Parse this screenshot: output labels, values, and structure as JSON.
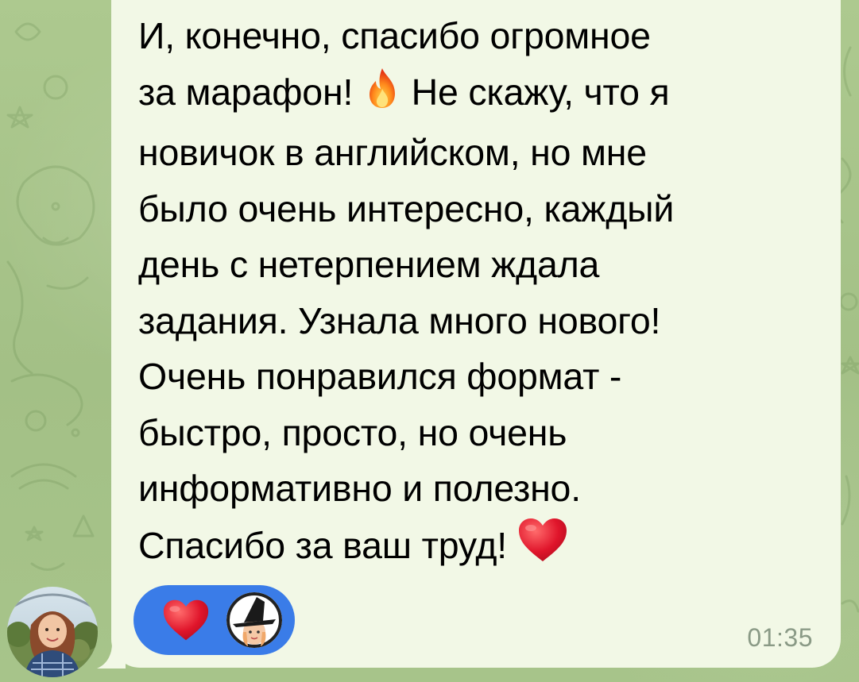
{
  "message": {
    "text_before_fire": "И, конечно, спасибо огромное\nза марафон! ",
    "text_after_fire": " Не скажу, что я\nновичок в английском, но мне\nбыло очень интересно, каждый\nдень с нетерпением ждала\nзадания. Узнала много нового!\nОчень понравился формат -\nбыстро, просто, но очень\nинформативно и полезно.\nСпасибо за ваш труд! ",
    "fire_emoji": "fire-icon",
    "heart_emoji": "red-heart-icon",
    "timestamp": "01:35"
  },
  "reactions": {
    "emoji": "red-heart-icon",
    "reactor_avatar": "witch-avatar"
  },
  "colors": {
    "chat_background": "#a9c58c",
    "bubble": "#f2f8e6",
    "reaction_pill": "#3a7ce8",
    "timestamp": "#8a9a86",
    "heart": "#e0152b"
  }
}
